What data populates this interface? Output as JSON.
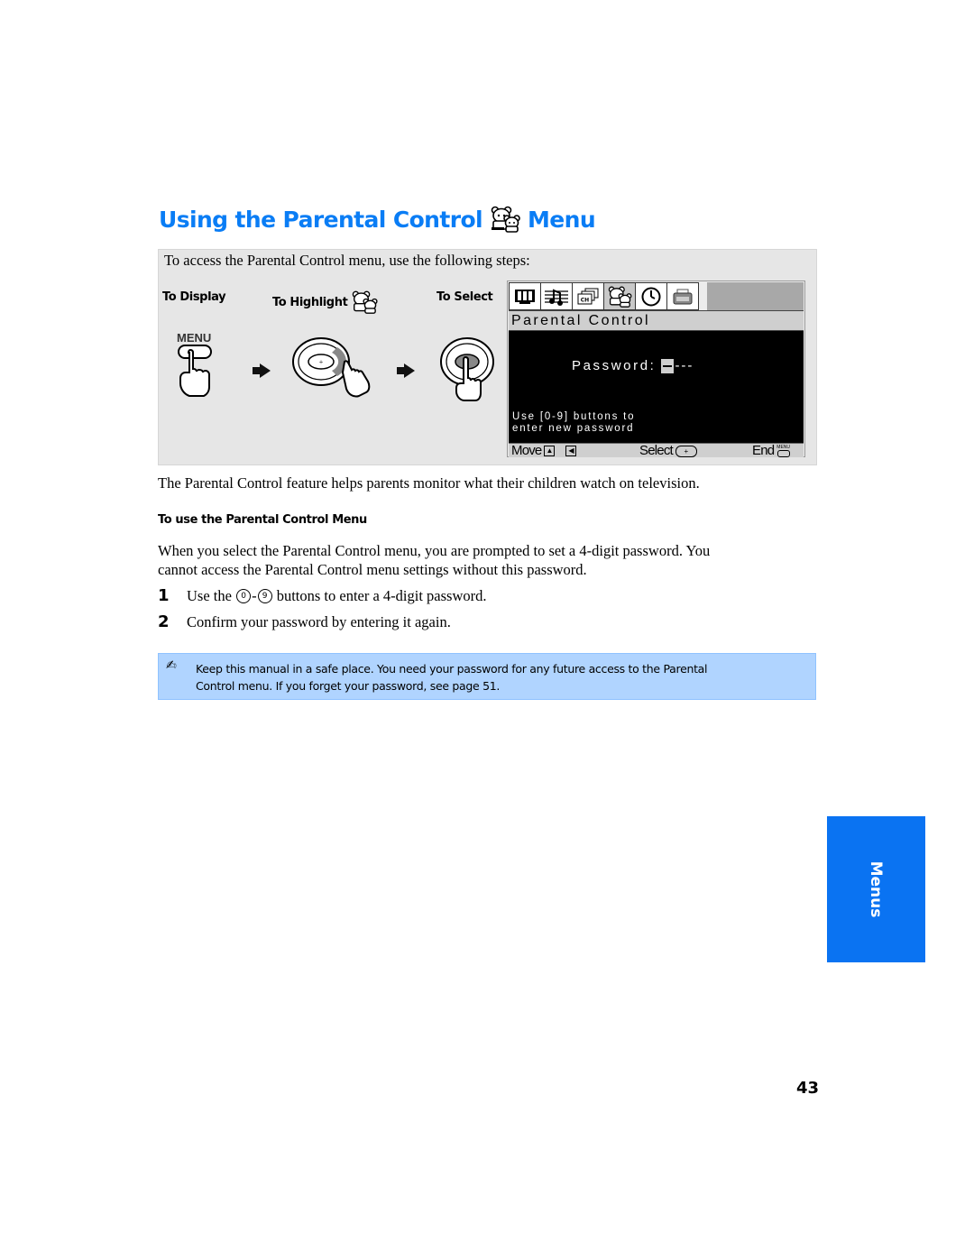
{
  "page": {
    "title_part1": "Using the Parental Control",
    "title_icon": "parental-control-bears-icon",
    "title_part2": "Menu",
    "page_number": "43",
    "side_tab": "Menus",
    "accent_color": "#0a7df5",
    "side_tab_color": "#0a73f2",
    "note_color": "#b0d4ff"
  },
  "panel": {
    "intro": "To access the Parental Control menu, use the following steps:",
    "steps": {
      "display": "To Display",
      "highlight": "To Highlight",
      "select": "To Select"
    },
    "menu_button_label": "MENU",
    "tv": {
      "icons": [
        "video-icon",
        "audio-icon",
        "channel-icon",
        "parental-control-icon",
        "timer-icon",
        "setup-icon"
      ],
      "active_icon": "parental-control-icon",
      "menu_title": "Parental Control",
      "password_label": "Password:",
      "password_placeholder": "---",
      "hint_line1": "Use [0-9] buttons to",
      "hint_line2": "enter new password",
      "footer": {
        "move": "Move",
        "select": "Select",
        "end": "End",
        "menu_small": "MENU"
      }
    }
  },
  "content": {
    "paragraph1": "The Parental Control feature helps parents monitor what their children watch on television.",
    "subheading": "To use the Parental Control Menu",
    "paragraph2_line1": "When you select the Parental Control menu, you are prompted to set a 4-digit password. You",
    "paragraph2_line2": "cannot access the Parental Control menu settings without this password.",
    "steps": [
      {
        "num": "1",
        "pre": "Use the",
        "btn_start": "0",
        "dash": "-",
        "btn_end": "9",
        "post": "buttons to enter a 4-digit password."
      },
      {
        "num": "2",
        "text": "Confirm your password by entering it again."
      }
    ],
    "note_icon": "✍",
    "note_line1": "Keep this manual in a safe place. You need your password for any future access to the Parental",
    "note_line2": "Control menu. If you forget your password, see page 51."
  }
}
